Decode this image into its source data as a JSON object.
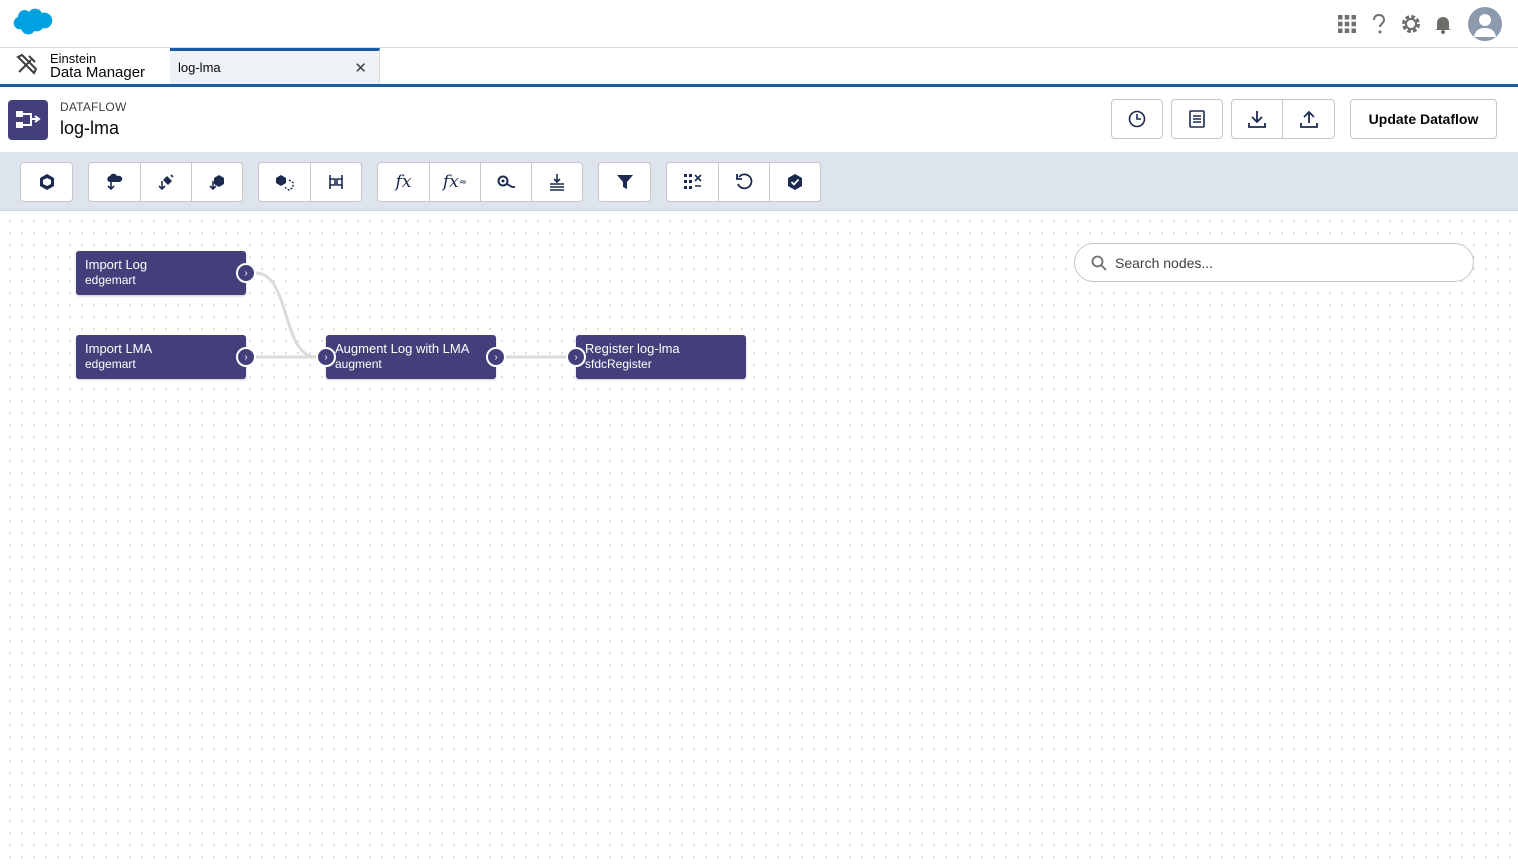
{
  "app": {
    "name_line1": "Einstein",
    "name_line2": "Data Manager"
  },
  "tab": {
    "label": "log-lma"
  },
  "header": {
    "type": "DATAFLOW",
    "title": "log-lma",
    "update_button": "Update Dataflow"
  },
  "search": {
    "placeholder": "Search nodes..."
  },
  "toolbar": {
    "fx_label": "fx",
    "fx2_label": "fx"
  },
  "nodes": [
    {
      "title": "Import Log",
      "type": "edgemart"
    },
    {
      "title": "Import LMA",
      "type": "edgemart"
    },
    {
      "title": "Augment Log with LMA",
      "type": "augment"
    },
    {
      "title": "Register log-lma",
      "type": "sfdcRegister"
    }
  ],
  "colors": {
    "node": "#433f7b",
    "accent": "#1c5aa2",
    "toolbar_bg": "#dde4ee",
    "logo": "#00a1e0"
  }
}
